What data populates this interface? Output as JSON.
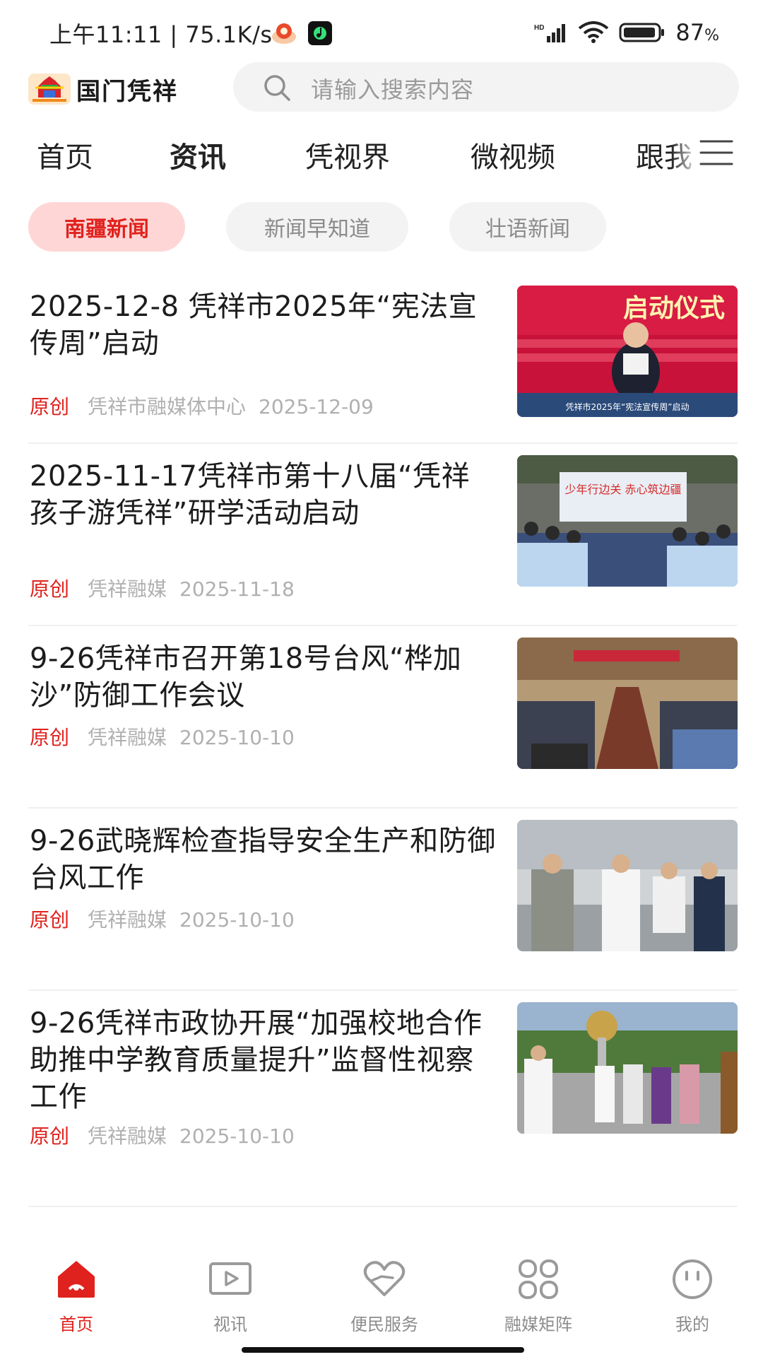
{
  "status_bar": {
    "time": "上午11:11 | 75.1K/s",
    "battery": "87"
  },
  "header": {
    "app_name": "国门凭祥",
    "search_placeholder": "请输入搜索内容"
  },
  "nav": {
    "tabs": [
      {
        "label": "首页"
      },
      {
        "label": "资讯"
      },
      {
        "label": "凭视界"
      },
      {
        "label": "微视频"
      },
      {
        "label": "跟我"
      }
    ],
    "active_index": 1
  },
  "subtabs": [
    {
      "label": "南疆新闻"
    },
    {
      "label": "新闻早知道"
    },
    {
      "label": "壮语新闻"
    }
  ],
  "news": [
    {
      "title": "2025-12-8 凭祥市2025年“宪法宣传周”启动",
      "tag": "原创",
      "source": "凭祥市融媒体中心",
      "date": "2025-12-09",
      "thumb_overlay": "启动仪式",
      "thumb_caption": "凭祥市2025年“宪法宣传周”启动"
    },
    {
      "title": "2025-11-17凭祥市第十八届“凭祥孩子游凭祥”研学活动启动",
      "tag": "原创",
      "source": "凭祥融媒",
      "date": "2025-11-18",
      "thumb_overlay": "少年行边关 赤心筑边疆"
    },
    {
      "title": "9-26凭祥市召开第18号台风“桦加沙”防御工作会议",
      "tag": "原创",
      "source": "凭祥融媒",
      "date": "2025-10-10"
    },
    {
      "title": "9-26武晓辉检查指导安全生产和防御台风工作",
      "tag": "原创",
      "source": "凭祥融媒",
      "date": "2025-10-10"
    },
    {
      "title": "9-26凭祥市政协开展“加强校地合作 助推中学教育质量提升”监督性视察工作",
      "tag": "原创",
      "source": "凭祥融媒",
      "date": "2025-10-10"
    }
  ],
  "bottom_nav": [
    {
      "label": "首页",
      "icon": "home-icon"
    },
    {
      "label": "视讯",
      "icon": "video-icon"
    },
    {
      "label": "便民服务",
      "icon": "heart-hand-icon"
    },
    {
      "label": "融媒矩阵",
      "icon": "grid-icon"
    },
    {
      "label": "我的",
      "icon": "profile-icon"
    }
  ],
  "colors": {
    "accent": "#e0221e",
    "subtab_active_bg": "#ffd6d6",
    "muted_text": "#b0b0b0"
  }
}
